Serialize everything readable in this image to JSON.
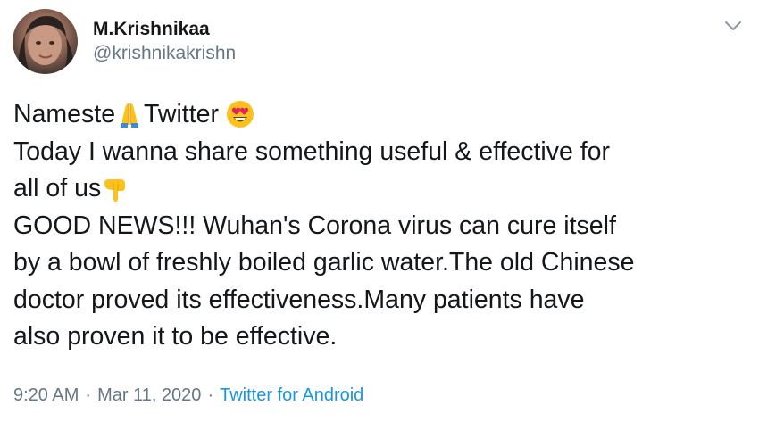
{
  "user": {
    "display_name": "M.Krishnikaa",
    "handle": "@krishnikakrishn"
  },
  "tweet": {
    "line1_a": "Nameste",
    "line1_b": "Twitter ",
    "line2": "Today I wanna share something useful & effective for",
    "line3": "all of us",
    "line4": "GOOD NEWS!!!  Wuhan's Corona virus can cure itself",
    "line5": "by a bowl of freshly boiled garlic water.The old Chinese",
    "line6": "doctor proved its effectiveness.Many patients have",
    "line7": "also proven it to be effective."
  },
  "icons": {
    "caret": "chevron-down-icon",
    "emoji1": "folded-hands-emoji",
    "emoji2": "heart-eyes-emoji",
    "emoji3": "pointing-down-emoji"
  },
  "meta": {
    "time": "9:20 AM",
    "separator1": "·",
    "date": "Mar 11, 2020",
    "separator2": "·",
    "source": "Twitter for Android"
  },
  "colors": {
    "text": "#14171a",
    "secondary": "#657786",
    "link": "#1b95e0"
  }
}
